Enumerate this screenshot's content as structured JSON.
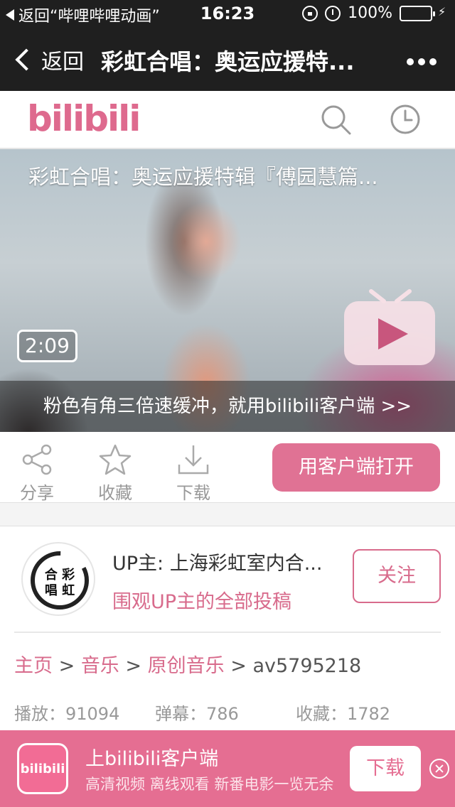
{
  "status_bar": {
    "back_app": "返回“哔哩哔哩动画”",
    "time": "16:23",
    "battery": "100%"
  },
  "nav": {
    "back_label": "返回",
    "title": "彩虹合唱：奥运应援特...",
    "more_icon": "more-dots-icon"
  },
  "header": {
    "logo": "bilibili",
    "search_icon": "search-icon",
    "history_icon": "clock-icon"
  },
  "video": {
    "title": "彩虹合唱：奥运应援特辑『傅园慧篇...",
    "duration": "2:09",
    "promo": "粉色有角三倍速缓冲，就用bilibili客户端 >>"
  },
  "actions": {
    "share": "分享",
    "favorite": "收藏",
    "download": "下载",
    "open_client": "用客户端打开"
  },
  "uploader": {
    "name": "UP主: 上海彩虹室内合...",
    "all_posts_link": "围观UP主的全部投稿",
    "follow": "关注",
    "avatar_text": "合彩唱虹"
  },
  "breadcrumb": {
    "home": "主页",
    "sep": ">",
    "music": "音乐",
    "original": "原创音乐",
    "av": "av5795218"
  },
  "stats": {
    "plays": "播放：91094",
    "danmaku": "弹幕：786",
    "favorites": "收藏：1782"
  },
  "banner": {
    "app_icon_text": "bilibili",
    "title": "上bilibili客户端",
    "subtitle": "高清视频 离线观看 新番电影一览无余",
    "download": "下载"
  },
  "colors": {
    "accent": "#e07294",
    "bar": "#1f1f1f",
    "battery": "#4cd964"
  }
}
